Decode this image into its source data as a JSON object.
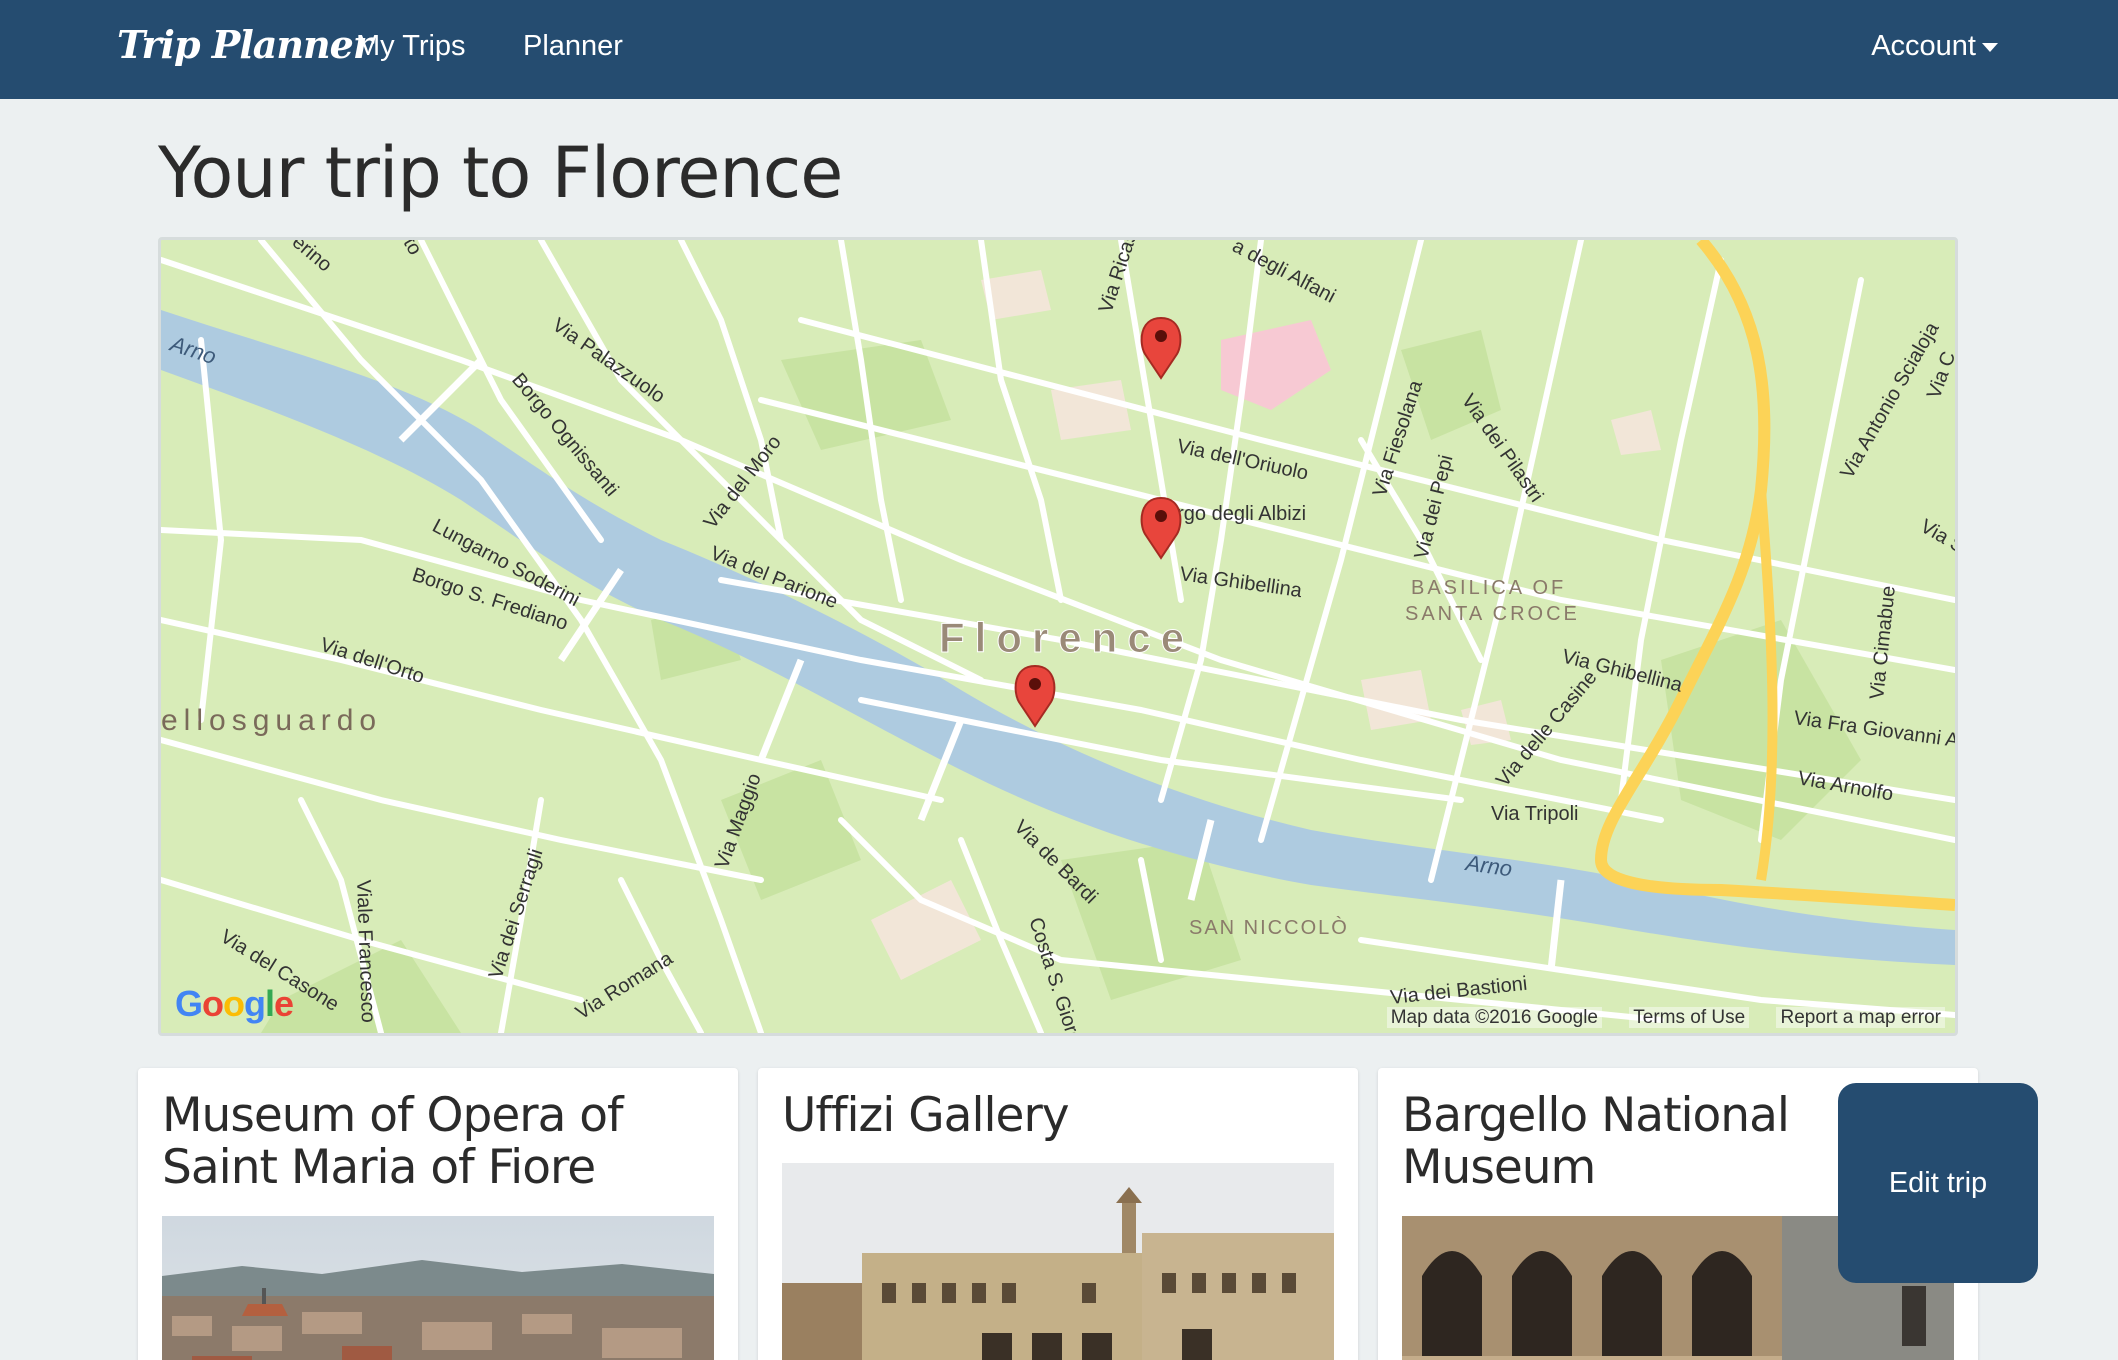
{
  "navbar": {
    "brand": "Trip Planner",
    "links": [
      {
        "label": "My Trips"
      },
      {
        "label": "Planner"
      }
    ],
    "account_label": "Account"
  },
  "page": {
    "title": "Your trip to Florence"
  },
  "map": {
    "city_label": "Florence",
    "footer": {
      "data": "Map data ©2016 Google",
      "terms": "Terms of Use",
      "report": "Report a map error"
    },
    "logo": {
      "g1": "G",
      "o1": "o",
      "o2": "o",
      "g2": "g",
      "l": "l",
      "e": "e"
    },
    "labels": {
      "arno_west": "Arno",
      "arno_east": "Arno",
      "via_palazzuolo": "Via Palazzuolo",
      "borgo_ognissanti": "Borgo Ognissanti",
      "lungarno_soderini": "Lungarno Soderini",
      "borgo_frediano": "Borgo S. Frediano",
      "via_orto": "Via dell'Orto",
      "bellosguardo": "ellosguardo",
      "via_del_moro": "Via del Moro",
      "via_del_parione": "Via del Parione",
      "via_maggio": "Via Maggio",
      "via_serragli": "Via dei Serragli",
      "viale_francesco": "Viale Francesco",
      "via_casone": "Via del Casone",
      "via_romana": "Via Romana",
      "via_ricasoli": "Via Ricas",
      "via_alfani": "a degli Alfani",
      "via_oriuolo": "Via dell'Oriuolo",
      "borgo_albizi": "orgo degli Albizi",
      "via_ghibellina": "Via Ghibellina",
      "via_fiesolana": "Via Fiesolana",
      "via_pepi": "Via dei Pepi",
      "via_pilastri": "Via dei Pilastri",
      "santa_croce_1": "BASILICA OF",
      "santa_croce_2": "SANTA CROCE",
      "via_ghibellina_east": "Via Ghibellina",
      "via_casine": "Via delle Casine",
      "via_tripoli": "Via Tripoli",
      "via_bardi": "Via de Bardi",
      "costa_giorgio": "Costa S. Giorg",
      "san_niccolo": "SAN NICCOLÒ",
      "via_bastioni": "Via dei Bastioni",
      "via_scialoja": "Via Antonio Scialoja",
      "via_cimabue": "Via Cimabue",
      "via_fra_giovanni": "Via Fra Giovanni A",
      "via_arnolfo": "Via Arnolfo",
      "via_s": "Via S",
      "via_c": "Via C",
      "erino": "erino",
      "to": "to"
    },
    "markers": 3
  },
  "places": [
    {
      "name": "Museum of Opera of Saint Maria of Fiore"
    },
    {
      "name": "Uffizi Gallery"
    },
    {
      "name": "Bargello National Museum"
    }
  ],
  "actions": {
    "edit_trip": "Edit trip"
  },
  "colors": {
    "navbar": "#254c70",
    "background": "#ecf0f1",
    "map_land": "#d8ecb8",
    "river": "#aecbe0",
    "marker": "#e8453c"
  }
}
